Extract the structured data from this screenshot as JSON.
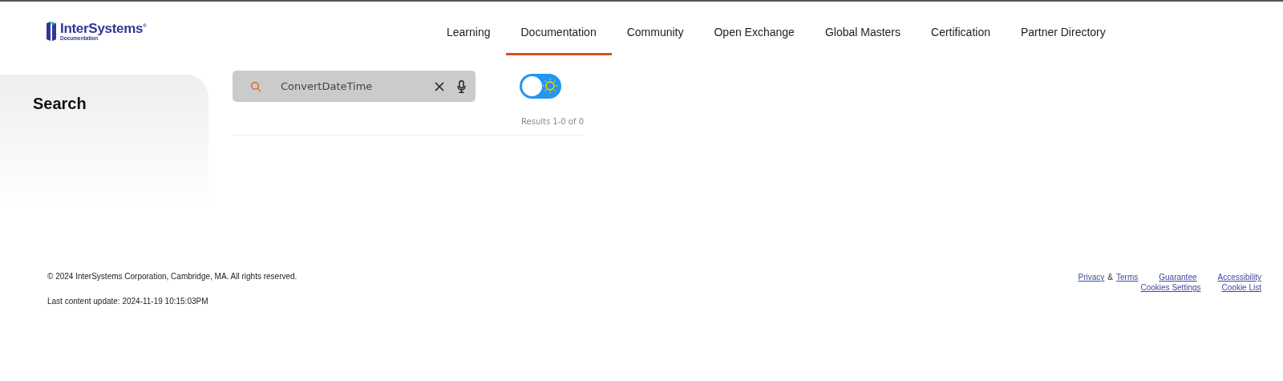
{
  "logo": {
    "name": "InterSystems",
    "trademark": "®",
    "subtitle": "Documentation"
  },
  "nav": [
    {
      "label": "Learning",
      "selected": false
    },
    {
      "label": "Documentation",
      "selected": true
    },
    {
      "label": "Community",
      "selected": false
    },
    {
      "label": "Open Exchange",
      "selected": false
    },
    {
      "label": "Global Masters",
      "selected": false
    },
    {
      "label": "Certification",
      "selected": false
    },
    {
      "label": "Partner Directory",
      "selected": false
    }
  ],
  "sidebar": {
    "title": "Search"
  },
  "search": {
    "value": "ConvertDateTime"
  },
  "theme_toggle": {
    "on": false
  },
  "results": "Results 1-0 of 0",
  "footer": {
    "copyright": "© 2024 InterSystems Corporation, Cambridge, MA. All rights reserved.",
    "updated": "Last content update: 2024-11-19 10:15:03PM",
    "link_rows": [
      [
        {
          "kind": "link",
          "text": "Privacy"
        },
        {
          "kind": "text",
          "text": "&"
        },
        {
          "kind": "link",
          "text": "Terms"
        },
        {
          "kind": "gap"
        },
        {
          "kind": "link",
          "text": "Guarantee"
        },
        {
          "kind": "gap"
        },
        {
          "kind": "link",
          "text": "Accessibility"
        }
      ],
      [
        {
          "kind": "link",
          "text": "Cookies Settings"
        },
        {
          "kind": "gap"
        },
        {
          "kind": "link",
          "text": "Cookie List"
        }
      ]
    ]
  }
}
